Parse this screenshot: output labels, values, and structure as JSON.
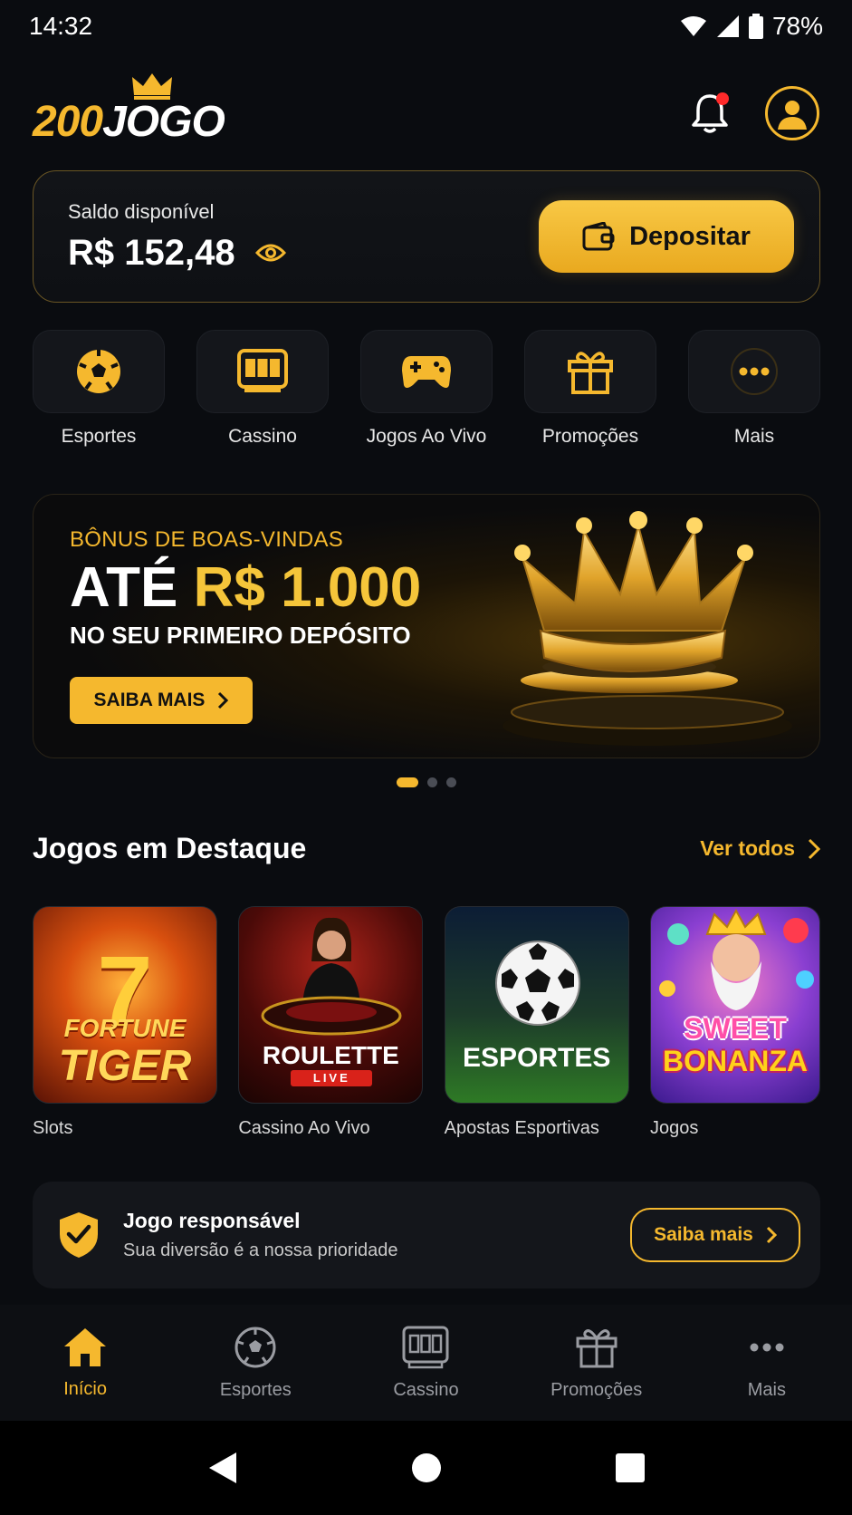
{
  "status_bar": {
    "time": "14:32",
    "battery": "78%"
  },
  "header": {
    "logo_part1": "200",
    "logo_part2": "JOGO",
    "notification_badge": true
  },
  "balance": {
    "label": "Saldo disponível",
    "value": "R$ 152,48",
    "deposit_label": "Depositar"
  },
  "categories": [
    {
      "label": "Esportes",
      "icon": "soccer-ball-icon"
    },
    {
      "label": "Cassino",
      "icon": "slot-machine-icon"
    },
    {
      "label": "Jogos Ao Vivo",
      "icon": "gamepad-icon"
    },
    {
      "label": "Promoções",
      "icon": "gift-icon"
    },
    {
      "label": "Mais",
      "icon": "more-dots-icon"
    }
  ],
  "banner": {
    "subtitle": "BÔNUS DE BOAS-VINDAS",
    "title_white": "ATÉ",
    "title_gold": "R$ 1.000",
    "description": "NO SEU PRIMEIRO DEPÓSITO",
    "button_label": "SAIBA MAIS",
    "active_slide": 1,
    "slide_count": 3
  },
  "featured": {
    "title": "Jogos em Destaque",
    "see_all": "Ver todos",
    "games": [
      {
        "thumb_title_1": "FORTUNE",
        "thumb_title_2": "TIGER",
        "label": "Slots"
      },
      {
        "thumb_title_1": "ROULETTE",
        "thumb_title_2": "LIVE",
        "label": "Cassino Ao Vivo"
      },
      {
        "thumb_title_1": "ESPORTES",
        "label": "Apostas Esportivas"
      },
      {
        "thumb_title_1": "SWEET",
        "thumb_title_2": "BONANZA",
        "label": "Jogos"
      }
    ]
  },
  "responsible": {
    "title": "Jogo responsável",
    "subtitle": "Sua diversão é a nossa prioridade",
    "button_label": "Saiba mais"
  },
  "bottom_nav": [
    {
      "label": "Início",
      "icon": "home-icon",
      "active": true
    },
    {
      "label": "Esportes",
      "icon": "soccer-ball-icon"
    },
    {
      "label": "Cassino",
      "icon": "slot-machine-icon"
    },
    {
      "label": "Promoções",
      "icon": "gift-icon"
    },
    {
      "label": "Mais",
      "icon": "more-dots-icon"
    }
  ],
  "colors": {
    "accent": "#f5b82e",
    "background": "#0a0c10",
    "card": "#14161b"
  }
}
